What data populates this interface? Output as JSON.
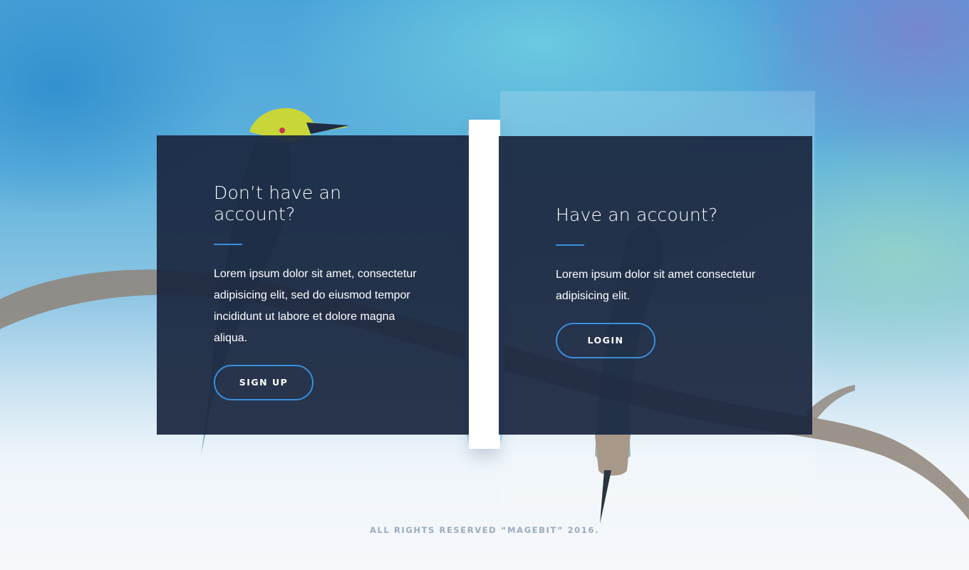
{
  "signup": {
    "heading": "Don’t have an account?",
    "body": "Lorem ipsum dolor sit amet, consectetur adipisicing elit, sed do eiusmod tempor incididunt ut labore et dolore magna aliqua.",
    "button_label": "SIGN UP"
  },
  "login": {
    "heading": "Have an account?",
    "body": "Lorem ipsum dolor sit amet consectetur adipisicing elit.",
    "button_label": "LOGIN"
  },
  "footer": {
    "text": "ALL RIGHTS RESERVED “MAGEBIT” 2016."
  },
  "colors": {
    "card_background": "#1b2740",
    "accent": "#3a8fdd",
    "footer_text": "#9aabc2"
  }
}
